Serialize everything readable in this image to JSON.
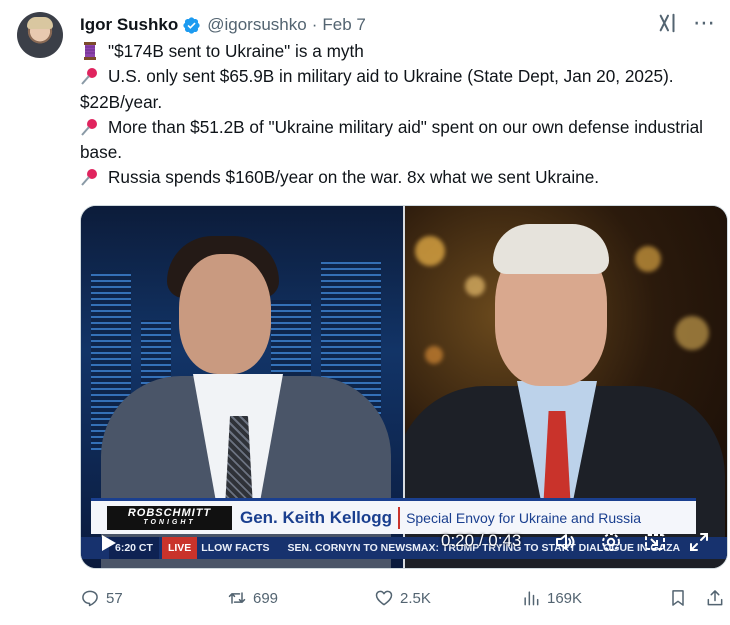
{
  "author": {
    "name": "Igor Sushko",
    "handle": "@igorsushko",
    "separator": "·",
    "date": "Feb 7",
    "verified": true,
    "avatar_icon": "avatar"
  },
  "tweet": {
    "line1": "\"$174B sent to Ukraine\" is a myth",
    "line2": "U.S. only sent $65.9B in military aid to Ukraine (State Dept, Jan 20, 2025). $22B/year.",
    "line3": "More than $51.2B of \"Ukraine military aid\" spent on our own defense industrial base.",
    "line4": "Russia spends $160B/year on the war. 8x what we sent Ukraine."
  },
  "video": {
    "show_name": "ROBSCHMITT",
    "show_sub": "TONIGHT",
    "guest_name": "Gen. Keith Kellogg",
    "guest_title": "Special Envoy for Ukraine and Russia",
    "ticker_time": "6:20 CT",
    "ticker_live": "LIVE",
    "ticker_text1": "LLOW FACTS",
    "ticker_text2": "SEN. CORNYN TO NEWSMAX: TRUMP TRYING TO START DIALOGUE IN GAZA",
    "current_time": "0:20",
    "time_separator": "/",
    "duration": "0:43"
  },
  "actions": {
    "replies": "57",
    "reposts": "699",
    "likes": "2.5K",
    "views": "169K"
  },
  "colors": {
    "accent": "#1d9bf0",
    "muted": "#536471",
    "text": "#0f1419",
    "lower_third_blue": "#1a3f8f",
    "live_red": "#c9332b"
  }
}
